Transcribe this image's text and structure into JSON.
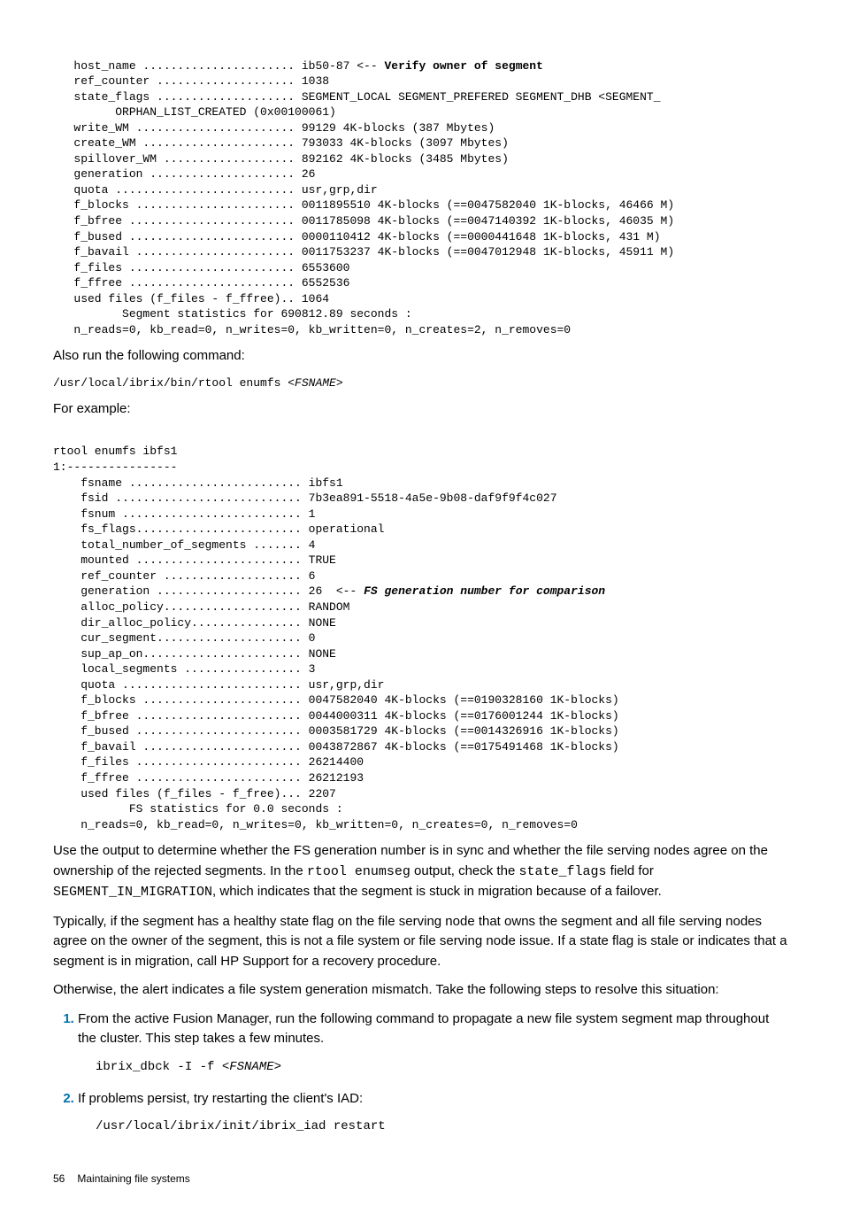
{
  "code1": {
    "l1a": "   host_name ...................... ib50-87 <-- ",
    "l1b": "Verify owner of segment",
    "l2": "   ref_counter .................... 1038",
    "l3": "   state_flags .................... SEGMENT_LOCAL SEGMENT_PREFERED SEGMENT_DHB <SEGMENT_",
    "l4": "         ORPHAN_LIST_CREATED (0x00100061)",
    "l5": "   write_WM ....................... 99129 4K-blocks (387 Mbytes)",
    "l6": "   create_WM ...................... 793033 4K-blocks (3097 Mbytes)",
    "l7": "   spillover_WM ................... 892162 4K-blocks (3485 Mbytes)",
    "l8": "   generation ..................... 26",
    "l9": "   quota .......................... usr,grp,dir",
    "l10": "   f_blocks ....................... 0011895510 4K-blocks (==0047582040 1K-blocks, 46466 M)",
    "l11": "   f_bfree ........................ 0011785098 4K-blocks (==0047140392 1K-blocks, 46035 M)",
    "l12": "   f_bused ........................ 0000110412 4K-blocks (==0000441648 1K-blocks, 431 M)",
    "l13": "   f_bavail ....................... 0011753237 4K-blocks (==0047012948 1K-blocks, 45911 M)",
    "l14": "   f_files ........................ 6553600",
    "l15": "   f_ffree ........................ 6552536",
    "l16": "   used files (f_files - f_ffree).. 1064",
    "l17": "          Segment statistics for 690812.89 seconds :",
    "l18": "   n_reads=0, kb_read=0, n_writes=0, kb_written=0, n_creates=2, n_removes=0"
  },
  "p1": "Also run the following command:",
  "cmd1a": "/usr/local/ibrix/bin/rtool enumfs ",
  "cmd1b": "<FSNAME>",
  "p2": "For example:",
  "code2": {
    "l1": "rtool enumfs ibfs1",
    "l2": "1:----------------",
    "l3": "    fsname ......................... ibfs1",
    "l4": "    fsid ........................... 7b3ea891-5518-4a5e-9b08-daf9f9f4c027",
    "l5": "    fsnum .......................... 1",
    "l6": "    fs_flags........................ operational",
    "l7": "    total_number_of_segments ....... 4",
    "l8": "    mounted ........................ TRUE",
    "l9": "    ref_counter .................... 6",
    "l10a": "    generation ..................... 26  <-- ",
    "l10b": "FS generation number for comparison",
    "l11": "    alloc_policy.................... RANDOM",
    "l12": "    dir_alloc_policy................ NONE",
    "l13": "    cur_segment..................... 0",
    "l14": "    sup_ap_on....................... NONE",
    "l15": "    local_segments ................. 3",
    "l16": "    quota .......................... usr,grp,dir",
    "l17": "    f_blocks ....................... 0047582040 4K-blocks (==0190328160 1K-blocks)",
    "l18": "    f_bfree ........................ 0044000311 4K-blocks (==0176001244 1K-blocks)",
    "l19": "    f_bused ........................ 0003581729 4K-blocks (==0014326916 1K-blocks)",
    "l20": "    f_bavail ....................... 0043872867 4K-blocks (==0175491468 1K-blocks)",
    "l21": "    f_files ........................ 26214400",
    "l22": "    f_ffree ........................ 26212193",
    "l23": "    used files (f_files - f_free)... 2207",
    "l24": "           FS statistics for 0.0 seconds :",
    "l25": "    n_reads=0, kb_read=0, n_writes=0, kb_written=0, n_creates=0, n_removes=0"
  },
  "p3a": "Use the output to determine whether the FS generation number is in sync and whether the file serving nodes agree on the ownership of the rejected segments. In the ",
  "p3b": "rtool enumseg",
  "p3c": " output, check the ",
  "p3d": "state_flags",
  "p3e": " field for ",
  "p3f": "SEGMENT_IN_MIGRATION",
  "p3g": ", which indicates that the segment is stuck in migration because of a failover.",
  "p4": "Typically, if the segment has a healthy state flag on the file serving node that owns the segment and all file serving nodes agree on the owner of the segment, this is not a file system or file serving node issue. If a state flag is stale or indicates that a segment is in migration, call HP Support for a recovery procedure.",
  "p5": "Otherwise, the alert indicates a file system generation mismatch. Take the following steps to resolve this situation:",
  "step1": "From the active Fusion Manager, run the following command to propagate a new file system segment map throughout the cluster. This step takes a few minutes.",
  "step1codea": "ibrix_dbck -I -f ",
  "step1codeb": "<FSNAME>",
  "step2": "If problems persist, try restarting the client's IAD:",
  "step2code": "/usr/local/ibrix/init/ibrix_iad restart",
  "footer_page": "56",
  "footer_title": "Maintaining file systems"
}
